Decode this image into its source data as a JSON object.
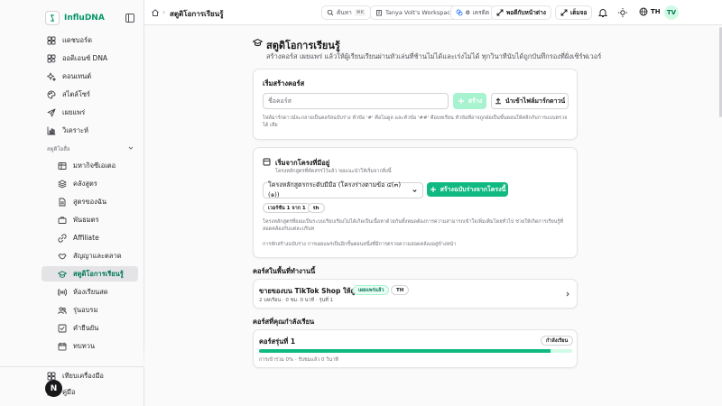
{
  "brand": {
    "name": "InfluDNA"
  },
  "sidebar": {
    "items": [
      {
        "label": "แดชบอร์ด",
        "icon": "dashboard-icon"
      },
      {
        "label": "ออดิเอนซ์ DNA",
        "icon": "dna-icon"
      },
      {
        "label": "คอนเทนต์",
        "icon": "sparkles-icon"
      },
      {
        "label": "สไตล์โซร์",
        "icon": "palette-icon"
      },
      {
        "label": "เผยแพร่",
        "icon": "send-icon"
      },
      {
        "label": "วิเคราะห์",
        "icon": "chart-icon"
      }
    ],
    "section_label": "สตูดิโอสื่อ",
    "sub_items": [
      {
        "label": "มหากิจซีเอเตอ",
        "icon": "table-icon"
      },
      {
        "label": "คลังสูตร",
        "icon": "layers-icon"
      },
      {
        "label": "สูตรของฉัน",
        "icon": "file-icon"
      },
      {
        "label": "พันธมตร",
        "icon": "briefcase-icon"
      },
      {
        "label": "Affiliate",
        "icon": "link-icon"
      },
      {
        "label": "สัญญาและตลาด",
        "icon": "handshake-icon"
      },
      {
        "label": "สตูดิโอการเรียนรู้",
        "icon": "graduation-cap-icon"
      },
      {
        "label": "ห้องเรียนสด",
        "icon": "broadcast-icon"
      },
      {
        "label": "รุ่นอบรม",
        "icon": "users-icon"
      },
      {
        "label": "คำยืนยัน",
        "icon": "check-square-icon"
      },
      {
        "label": "ทบทวน",
        "icon": "calendar-icon"
      }
    ],
    "footer": [
      {
        "label": "เทียบเครื่องมือ",
        "icon": "grid-icon"
      },
      {
        "label": "คู่มือ",
        "icon": "book-icon"
      }
    ],
    "avatar_letter": "N"
  },
  "topbar": {
    "breadcrumb": "สตูดิโอการเรียนรู้",
    "search_label": "ค้นหา",
    "search_kbd": "⌘K",
    "workspace": "Tanya Volt's Workspace",
    "credits": "0",
    "credits_label": "เครดิต",
    "back_home": "พอดีกับหน้าต่าง",
    "exit": "เต็มจอ",
    "lang": "TH",
    "user_initials": "TV"
  },
  "page": {
    "title": "สตูดิโอการเรียนรู้",
    "subtitle": "สร้างคอร์ส เผยแพร่ แล้วให้ผู้เรียนเรียนผ่านหัวเล่นที่ช้านไม่ได้และเร่งไม่ได้ ทุกวินาทีนับได้ถูกบันทึกรองที่ฝั่งเซิร์ฟเวอร์"
  },
  "create": {
    "title": "เริ่มสร้างคอร์ส",
    "placeholder": "ชื่อคอร์ส",
    "create_button": "สร้าง",
    "import_button": "นำเข้าไฟล์มาร์กดาวน์",
    "hint": "ไฟล์มาร์กดาวน์จะกลายเป็นคอร์สฉบับร่าง หัวข้อ '#' คือโมดูล และหัวข้อ '##' คือบทเรียน หัวข้อที่อาจถูกฝ่อเป็นขั้นตอนให้คลิกกับการแบบตรวจได้ เสีย"
  },
  "template": {
    "title": "เริ่มจากโครงที่มีอยู่",
    "subtitle": "โครงหลักสูตรที่คัดสรรไว้แล้ว ขอแนะนำให้เริ่มจากสิ่งนี้",
    "select_value": "โครงหลักสูตรกระดับมีมือ (โครงร่างตามข้อ ๔(๓)(๑))",
    "build_button": "สร้างฉบับร่างจากโครงนี้",
    "version_badge": "เวอร์ชัน 1 จาก 1",
    "lang_badge": "th",
    "desc": "โครงหลักสูตรที่ยอมเป็นระบบเรียบเรียงไม่ได้เกิดเป็นเนื้อหาด้วยกันทั้งหมดต้องการความสามารถเข้าใจเพิ่มเติมโดยทั่วไป ช่วยให้เกิดการเรียนรู้ที่สอดคล้องกับแต่ละบริบท",
    "note": "การหักสร้างฉบับร่าง การเผยแพร่เป็นอีกขั้นตอนหนึ่งที่มีการตรวจความสอดคล้องอยู่ข้างหน้า"
  },
  "workspace_courses": {
    "heading": "คอร์สในพื้นที่ทำงานนี้",
    "course_title": "ขายของบน TikTok Shop ให้ถูกกฎ",
    "status_badge": "เผยแพร่แล้ว",
    "lang_badge": "TH",
    "meta": "2 บทเรียน · 0 ชม. 0 นาที · รุ่นที่ 1"
  },
  "learning": {
    "heading": "คอร์สที่คุณกำลังเรียน",
    "cohort": "คอร์สรุ่นที่ 1",
    "status": "กำลังเรียน",
    "progress": 0.93,
    "progress_text": "การเข้าร่วม 0% · รับชมแล้ว 0 วินาที"
  },
  "colors": {
    "accent": "#10b981",
    "brand": "#059669"
  }
}
